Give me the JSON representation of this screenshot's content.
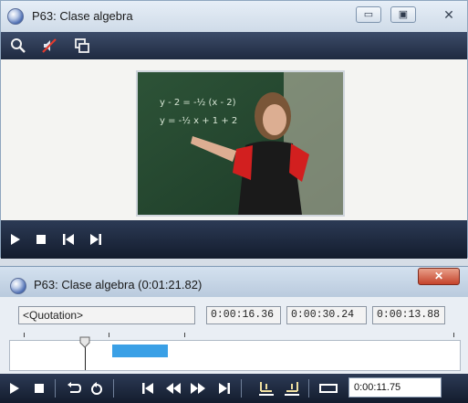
{
  "player": {
    "title": "P63: Clase algebra",
    "minimize_glyph": "▭",
    "maximize_glyph": "▣",
    "close_glyph": "✕",
    "toolbar_icons": [
      "zoom-icon",
      "mute-icon",
      "copy-windows-icon"
    ],
    "board_lines": [
      "y - 2 = -½ (x - 2)",
      "y = -½ x + 1 + 2"
    ]
  },
  "transcription": {
    "title": "P63: Clase algebra (0:01:21.82)",
    "close_glyph": "✕",
    "quotation_label": "<Quotation>",
    "start_time": "0:00:16.36",
    "end_time": "0:00:30.24",
    "duration": "0:00:13.88",
    "current_time": "0:00:11.75",
    "selection_color": "#3aa0e6"
  }
}
